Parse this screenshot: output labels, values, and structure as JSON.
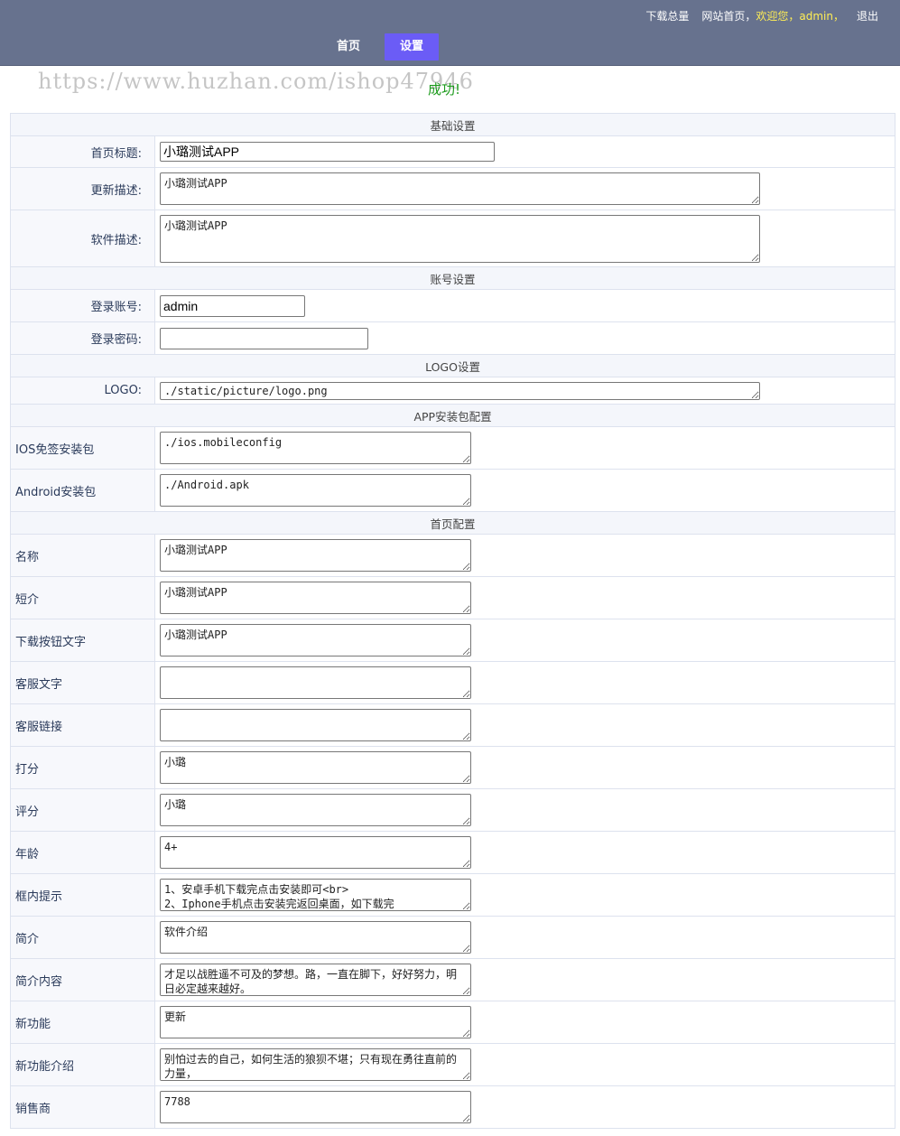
{
  "header": {
    "links": [
      "下载总量",
      "网站首页，",
      "欢迎您，admin，",
      "退出"
    ],
    "nav": [
      "首页",
      "设置"
    ]
  },
  "content": {
    "watermark": "https://www.huzhan.com/ishop47946",
    "success_message": "成功!"
  },
  "sections": {
    "basic": "基础设置",
    "account": "账号设置",
    "logo": "LOGO设置",
    "app": "APP安装包配置",
    "home": "首页配置"
  },
  "fields": {
    "home_title": {
      "label": "首页标题:",
      "value": "小璐测试APP"
    },
    "update_desc": {
      "label": "更新描述:",
      "value": "小璐测试APP"
    },
    "software_desc": {
      "label": "软件描述:",
      "value": "小璐测试APP"
    },
    "login_account": {
      "label": "登录账号:",
      "value": "admin"
    },
    "login_password": {
      "label": "登录密码:",
      "value": ""
    },
    "logo": {
      "label": "LOGO:",
      "value": "./static/picture/logo.png"
    },
    "ios_pkg": {
      "label": "IOS免签安装包",
      "value": "./ios.mobileconfig"
    },
    "android_pkg": {
      "label": "Android安装包",
      "value": "./Android.apk"
    },
    "name": {
      "label": "名称",
      "value": "小璐测试APP"
    },
    "intro_short": {
      "label": "短介",
      "value": "小璐测试APP"
    },
    "download_btn_text": {
      "label": "下载按钮文字",
      "value": "小璐测试APP"
    },
    "service_text": {
      "label": "客服文字",
      "value": ""
    },
    "service_link": {
      "label": "客服链接",
      "value": ""
    },
    "score": {
      "label": "打分",
      "value": "小璐"
    },
    "rating": {
      "label": "评分",
      "value": "小璐"
    },
    "age": {
      "label": "年龄",
      "value": "4+"
    },
    "box_tip": {
      "label": "框内提示",
      "value": "1、安卓手机下载完点击安装即可<br>\n2、Iphone手机点击安装完返回桌面，如下载完"
    },
    "intro": {
      "label": "简介",
      "value": "软件介绍"
    },
    "intro_content": {
      "label": "简介内容",
      "value": "才足以战胜遥不可及的梦想。路，一直在脚下，好好努力，明日必定越来越好。"
    },
    "new_feature": {
      "label": "新功能",
      "value": "更新"
    },
    "new_feature_intro": {
      "label": "新功能介绍",
      "value": "别怕过去的自己，如何生活的狼狈不堪；只有现在勇往直前的力量，"
    },
    "seller": {
      "label": "销售商",
      "value": "7788"
    }
  }
}
